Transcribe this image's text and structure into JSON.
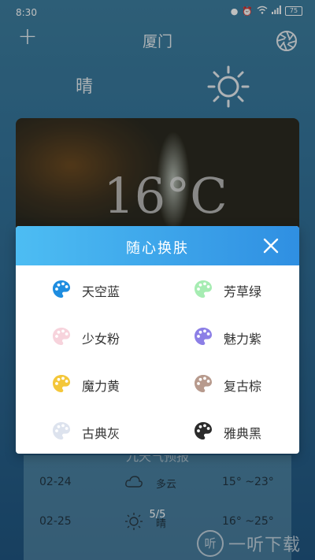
{
  "status_bar": {
    "time": "8:30",
    "battery": "75"
  },
  "topbar": {
    "city": "厦门"
  },
  "current": {
    "condition": "晴",
    "temperature": "16°C"
  },
  "forecast": {
    "header": "九天气预报",
    "rows": [
      {
        "date": "02-24",
        "condition": "多云",
        "range": "15° ~23°"
      },
      {
        "date": "02-25",
        "condition": "晴",
        "range": "16° ~25°"
      }
    ]
  },
  "pager": {
    "label": "5/5"
  },
  "watermark": {
    "logo": "听",
    "text": "一听下载"
  },
  "dialog": {
    "title": "随心换肤",
    "options": [
      {
        "label": "天空蓝",
        "color": "#1e8de0"
      },
      {
        "label": "芳草绿",
        "color": "#a6ecb2"
      },
      {
        "label": "少女粉",
        "color": "#f7d3dc"
      },
      {
        "label": "魅力紫",
        "color": "#8c7fe6"
      },
      {
        "label": "魔力黄",
        "color": "#f4c73a"
      },
      {
        "label": "复古棕",
        "color": "#b79a8d"
      },
      {
        "label": "古典灰",
        "color": "#dde3ee"
      },
      {
        "label": "雅典黑",
        "color": "#2b2b2b"
      }
    ]
  }
}
